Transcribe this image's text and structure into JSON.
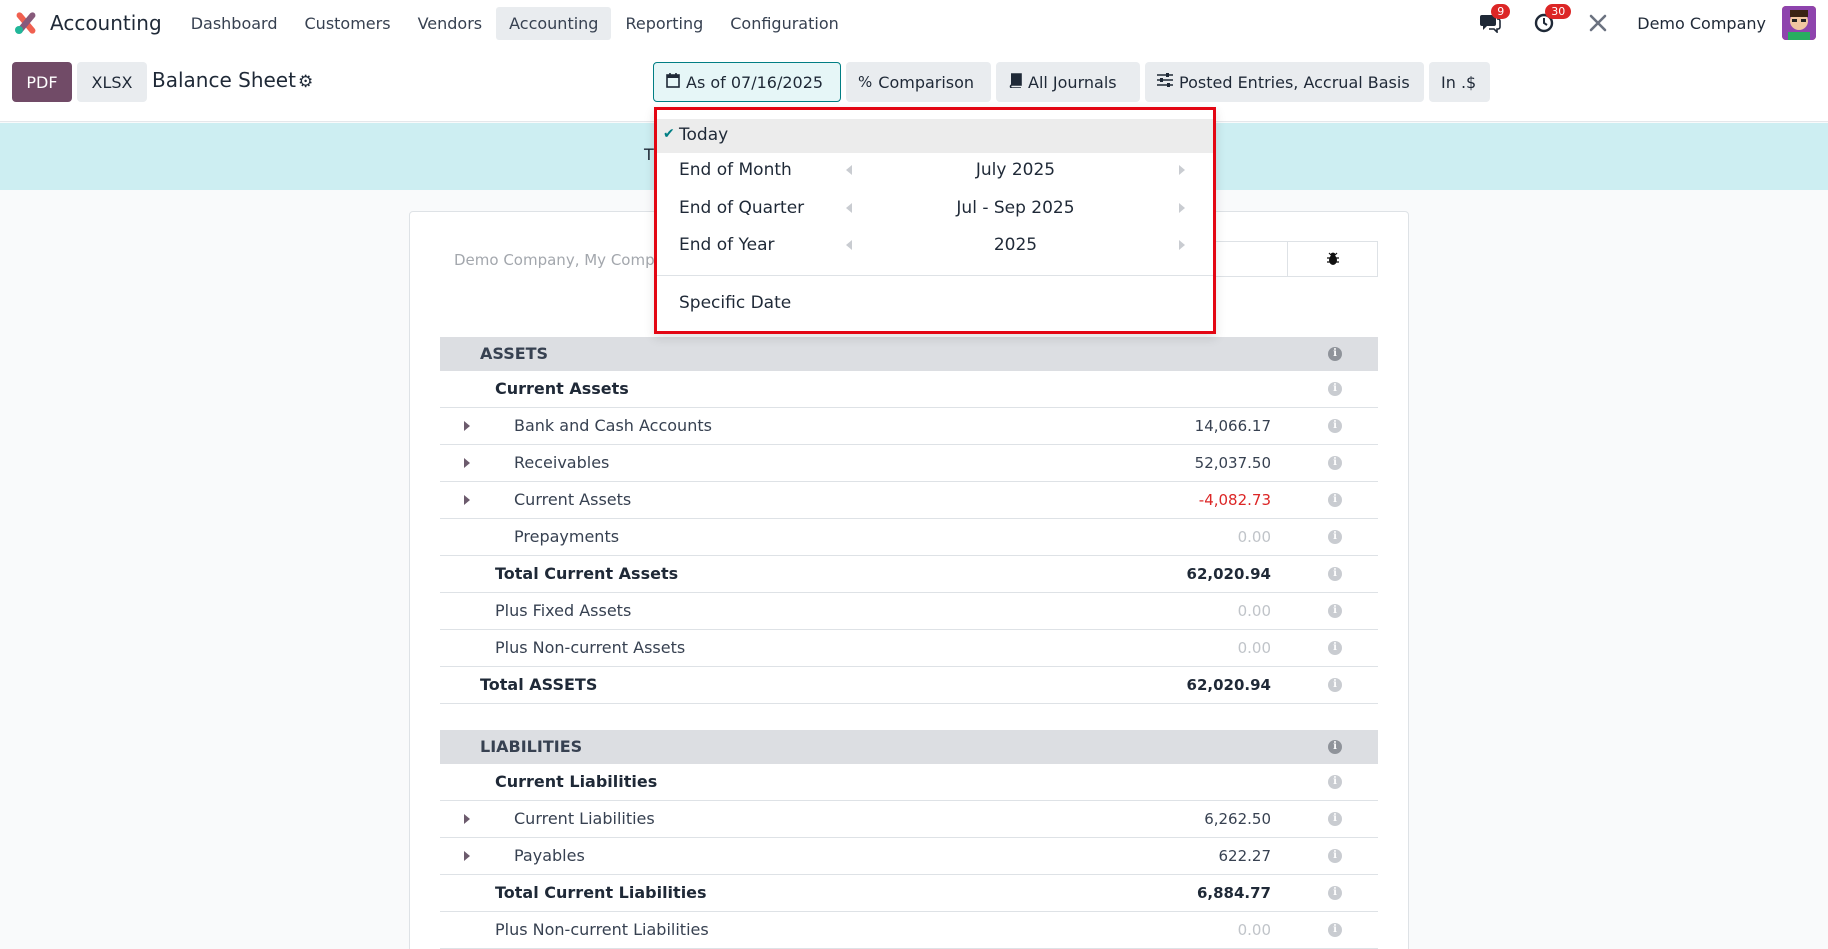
{
  "navbar": {
    "app_name": "Accounting",
    "menu": [
      "Dashboard",
      "Customers",
      "Vendors",
      "Accounting",
      "Reporting",
      "Configuration"
    ],
    "active_menu": "Accounting",
    "messages_count": "9",
    "activities_count": "30",
    "company": "Demo Company"
  },
  "toolbar": {
    "pdf_label": "PDF",
    "xlsx_label": "XLSX",
    "title": "Balance Sheet",
    "date_filter": "As of 07/16/2025",
    "comparison": "Comparison",
    "journals": "All Journals",
    "entries": "Posted Entries, Accrual Basis",
    "currency": "In .$"
  },
  "banner": {
    "text": "T"
  },
  "report": {
    "company_line": "Demo Company, My Compa",
    "rows": [
      {
        "label": "ASSETS",
        "amount": "",
        "type": "section"
      },
      {
        "label": "Current Assets",
        "amount": "",
        "type": "l1 total"
      },
      {
        "label": "Bank and Cash Accounts",
        "amount": "14,066.17",
        "type": "l2",
        "expandable": true
      },
      {
        "label": "Receivables",
        "amount": "52,037.50",
        "type": "l2",
        "expandable": true
      },
      {
        "label": "Current Assets",
        "amount": "-4,082.73",
        "type": "l2",
        "expandable": true,
        "negative": true
      },
      {
        "label": "Prepayments",
        "amount": "0.00",
        "type": "l2",
        "zero": true
      },
      {
        "label": "Total Current Assets",
        "amount": "62,020.94",
        "type": "l1 total"
      },
      {
        "label": "Plus Fixed Assets",
        "amount": "0.00",
        "type": "l1",
        "zero": true
      },
      {
        "label": "Plus Non-current Assets",
        "amount": "0.00",
        "type": "l1",
        "zero": true
      },
      {
        "label": "Total ASSETS",
        "amount": "62,020.94",
        "type": "grand total"
      }
    ],
    "rows2": [
      {
        "label": "LIABILITIES",
        "amount": "",
        "type": "section"
      },
      {
        "label": "Current Liabilities",
        "amount": "",
        "type": "l1 total"
      },
      {
        "label": "Current Liabilities",
        "amount": "6,262.50",
        "type": "l2",
        "expandable": true
      },
      {
        "label": "Payables",
        "amount": "622.27",
        "type": "l2",
        "expandable": true
      },
      {
        "label": "Total Current Liabilities",
        "amount": "6,884.77",
        "type": "l1 total"
      },
      {
        "label": "Plus Non-current Liabilities",
        "amount": "0.00",
        "type": "l1",
        "zero": true
      }
    ]
  },
  "date_dropdown": {
    "today": "Today",
    "end_of_month": "End of Month",
    "month_value": "July 2025",
    "end_of_quarter": "End of Quarter",
    "quarter_value": "Jul - Sep 2025",
    "end_of_year": "End of Year",
    "year_value": "2025",
    "specific_date": "Specific Date"
  }
}
